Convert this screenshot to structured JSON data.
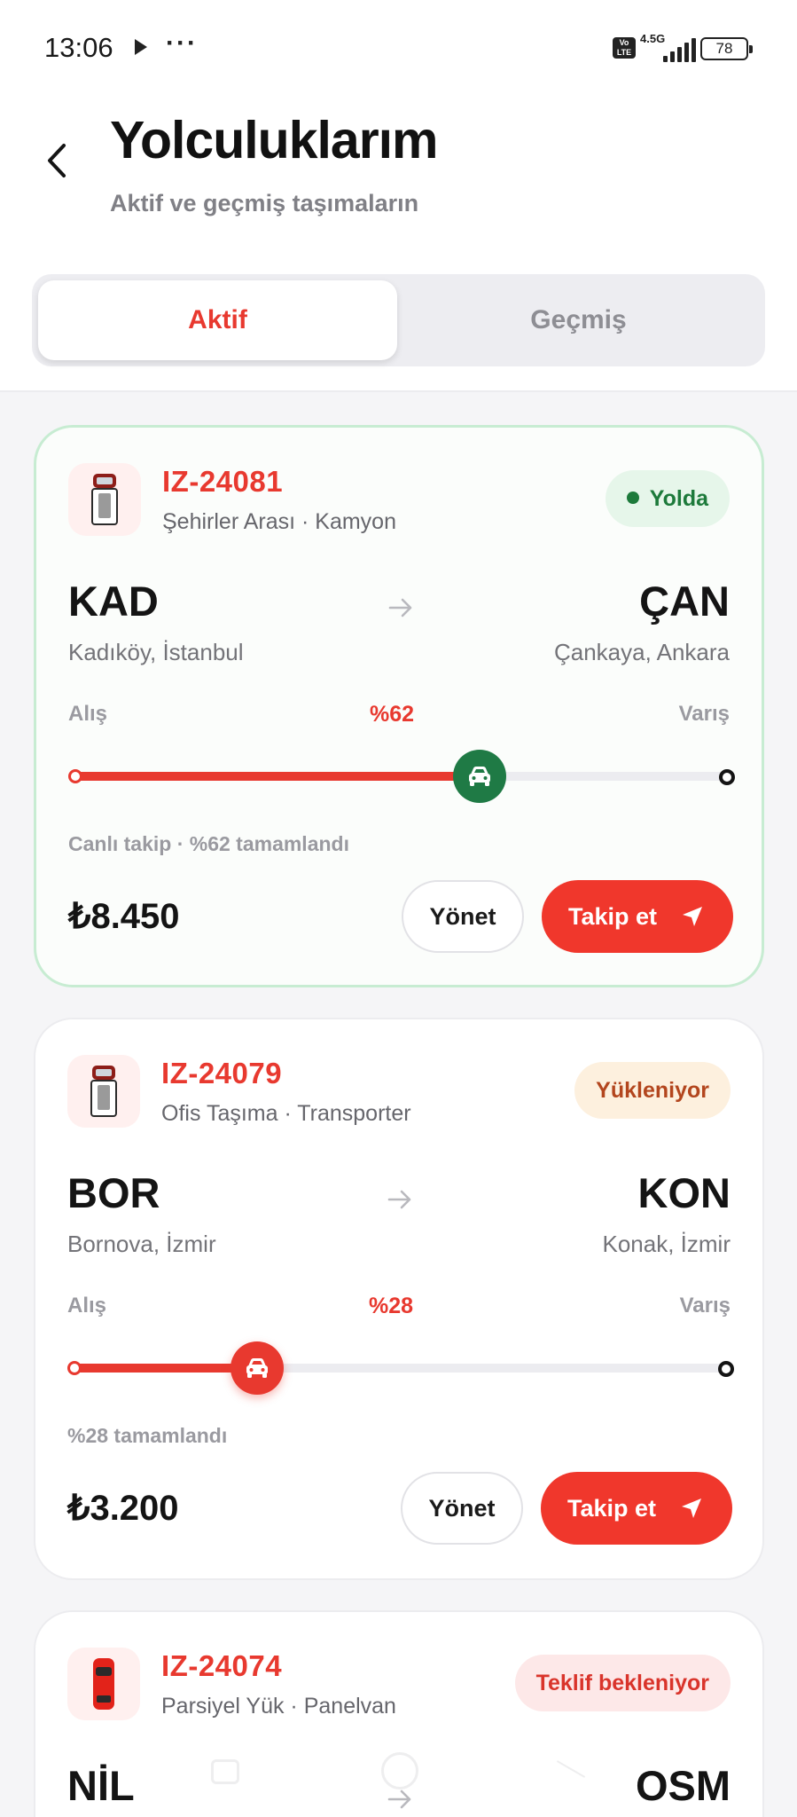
{
  "status_bar": {
    "time": "13:06",
    "network": "4.5G",
    "volte": "Vo LTE",
    "battery": "78"
  },
  "header": {
    "title": "Yolculuklarım",
    "subtitle": "Aktif ve geçmiş taşımaların"
  },
  "tabs": [
    {
      "label": "Aktif",
      "active": true
    },
    {
      "label": "Geçmiş",
      "active": false
    }
  ],
  "colors": {
    "accent": "#e8392f",
    "live_green": "#1f7a45"
  },
  "rides": [
    {
      "code": "IZ-24081",
      "service": "Şehirler Arası · Kamyon",
      "status": "Yolda",
      "from_code": "KAD",
      "from_city": "Kadıköy, İstanbul",
      "to_code": "ÇAN",
      "to_city": "Çankaya, Ankara",
      "pickup_label": "Alış",
      "dropoff_label": "Varış",
      "progress_label": "%62",
      "progress": 0.62,
      "note": "Canlı takip · %62 tamamlandı",
      "price": "₺8.450",
      "manage_label": "Yönet",
      "track_label": "Takip et"
    },
    {
      "code": "IZ-24079",
      "service": "Ofis Taşıma · Transporter",
      "status": "Yükleniyor",
      "from_code": "BOR",
      "from_city": "Bornova, İzmir",
      "to_code": "KON",
      "to_city": "Konak, İzmir",
      "pickup_label": "Alış",
      "dropoff_label": "Varış",
      "progress_label": "%28",
      "progress": 0.28,
      "note": "%28 tamamlandı",
      "price": "₺3.200",
      "manage_label": "Yönet",
      "track_label": "Takip et"
    },
    {
      "code": "IZ-24074",
      "service": "Parsiyel Yük · Panelvan",
      "status": "Teklif bekleniyor",
      "from_code": "NİL",
      "to_code": "OSM"
    }
  ]
}
